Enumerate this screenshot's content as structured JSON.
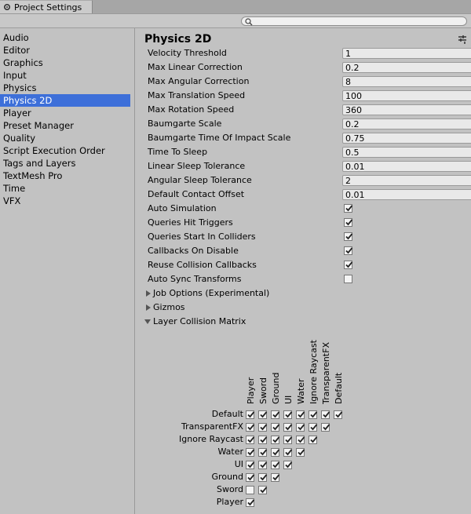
{
  "window": {
    "tab_title": "Project Settings",
    "icon": "gear-icon"
  },
  "toolbar": {
    "search_placeholder": "",
    "search_icon": "search-icon"
  },
  "sidebar": {
    "items": [
      {
        "label": "Audio",
        "selected": false
      },
      {
        "label": "Editor",
        "selected": false
      },
      {
        "label": "Graphics",
        "selected": false
      },
      {
        "label": "Input",
        "selected": false
      },
      {
        "label": "Physics",
        "selected": false
      },
      {
        "label": "Physics 2D",
        "selected": true
      },
      {
        "label": "Player",
        "selected": false
      },
      {
        "label": "Preset Manager",
        "selected": false
      },
      {
        "label": "Quality",
        "selected": false
      },
      {
        "label": "Script Execution Order",
        "selected": false
      },
      {
        "label": "Tags and Layers",
        "selected": false
      },
      {
        "label": "TextMesh Pro",
        "selected": false
      },
      {
        "label": "Time",
        "selected": false
      },
      {
        "label": "VFX",
        "selected": false
      }
    ]
  },
  "main": {
    "title": "Physics 2D",
    "settings_icon": "settings-menu-icon",
    "fields": [
      {
        "label": "Velocity Threshold",
        "value": "1"
      },
      {
        "label": "Max Linear Correction",
        "value": "0.2"
      },
      {
        "label": "Max Angular Correction",
        "value": "8"
      },
      {
        "label": "Max Translation Speed",
        "value": "100"
      },
      {
        "label": "Max Rotation Speed",
        "value": "360"
      },
      {
        "label": "Baumgarte Scale",
        "value": "0.2"
      },
      {
        "label": "Baumgarte Time Of Impact Scale",
        "value": "0.75"
      },
      {
        "label": "Time To Sleep",
        "value": "0.5"
      },
      {
        "label": "Linear Sleep Tolerance",
        "value": "0.01"
      },
      {
        "label": "Angular Sleep Tolerance",
        "value": "2"
      },
      {
        "label": "Default Contact Offset",
        "value": "0.01"
      }
    ],
    "toggles": [
      {
        "label": "Auto Simulation",
        "checked": true
      },
      {
        "label": "Queries Hit Triggers",
        "checked": true
      },
      {
        "label": "Queries Start In Colliders",
        "checked": true
      },
      {
        "label": "Callbacks On Disable",
        "checked": true
      },
      {
        "label": "Reuse Collision Callbacks",
        "checked": true
      },
      {
        "label": "Auto Sync Transforms",
        "checked": false
      }
    ],
    "foldouts": [
      {
        "label": "Job Options (Experimental)",
        "expanded": false
      },
      {
        "label": "Gizmos",
        "expanded": false
      },
      {
        "label": "Layer Collision Matrix",
        "expanded": true
      }
    ]
  },
  "matrix": {
    "columns": [
      "Player",
      "Sword",
      "Ground",
      "UI",
      "Water",
      "Ignore Raycast",
      "TransparentFX",
      "Default"
    ],
    "rows": [
      {
        "label": "Default",
        "checks": [
          true,
          true,
          true,
          true,
          true,
          true,
          true,
          true
        ]
      },
      {
        "label": "TransparentFX",
        "checks": [
          true,
          true,
          true,
          true,
          true,
          true,
          true
        ]
      },
      {
        "label": "Ignore Raycast",
        "checks": [
          true,
          true,
          true,
          true,
          true,
          true
        ]
      },
      {
        "label": "Water",
        "checks": [
          true,
          true,
          true,
          true,
          true
        ]
      },
      {
        "label": "UI",
        "checks": [
          true,
          true,
          true,
          true
        ]
      },
      {
        "label": "Ground",
        "checks": [
          true,
          true,
          true
        ]
      },
      {
        "label": "Sword",
        "checks": [
          false,
          true
        ]
      },
      {
        "label": "Player",
        "checks": [
          true
        ]
      }
    ]
  },
  "colors": {
    "selection": "#3d6fd9",
    "background": "#c2c2c2",
    "field": "#e9e9e9"
  }
}
